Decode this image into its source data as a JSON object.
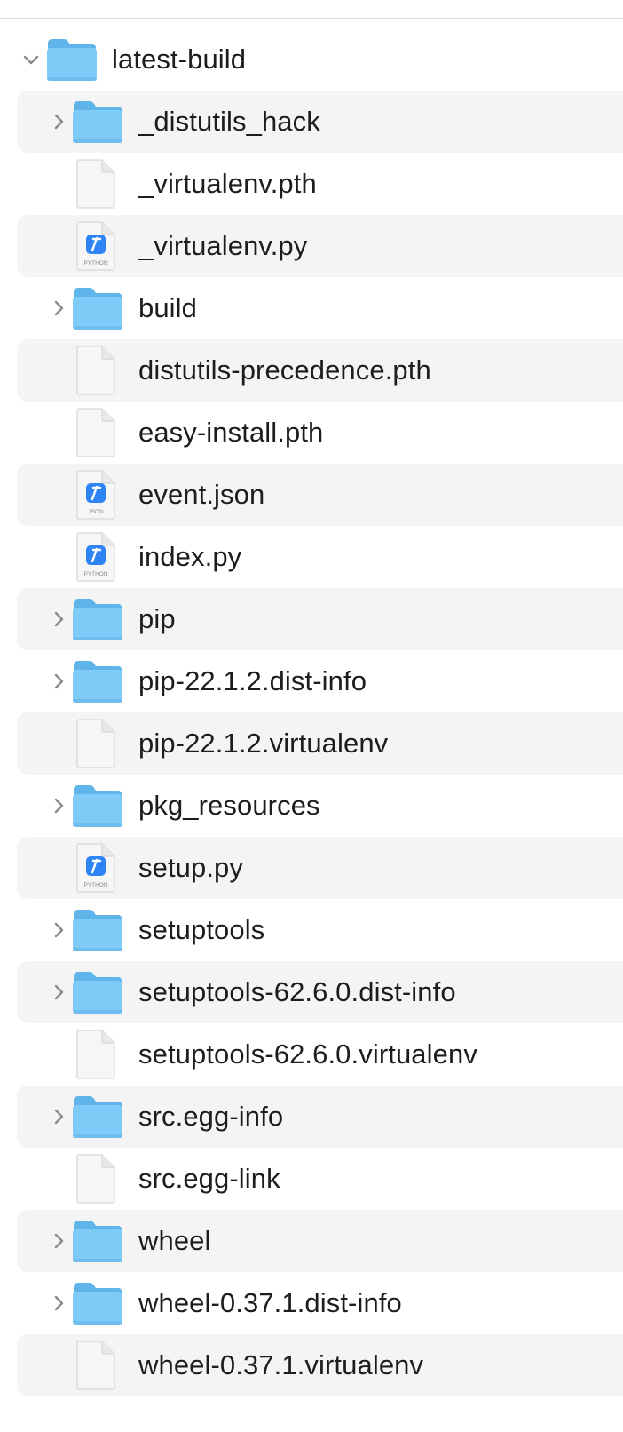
{
  "root": {
    "name": "latest-build",
    "icon": "folder-icon",
    "expanded": true
  },
  "items": [
    {
      "name": "_distutils_hack",
      "kind": "folder",
      "icon": "folder-icon"
    },
    {
      "name": "_virtualenv.pth",
      "kind": "file",
      "icon": "document-icon"
    },
    {
      "name": "_virtualenv.py",
      "kind": "python",
      "icon": "python-file-icon",
      "badge": "PYTHON"
    },
    {
      "name": "build",
      "kind": "folder",
      "icon": "folder-icon"
    },
    {
      "name": "distutils-precedence.pth",
      "kind": "file",
      "icon": "document-icon"
    },
    {
      "name": "easy-install.pth",
      "kind": "file",
      "icon": "document-icon"
    },
    {
      "name": "event.json",
      "kind": "json",
      "icon": "json-file-icon",
      "badge": "JSON"
    },
    {
      "name": "index.py",
      "kind": "python",
      "icon": "python-file-icon",
      "badge": "PYTHON"
    },
    {
      "name": "pip",
      "kind": "folder",
      "icon": "folder-icon"
    },
    {
      "name": "pip-22.1.2.dist-info",
      "kind": "folder",
      "icon": "folder-icon"
    },
    {
      "name": "pip-22.1.2.virtualenv",
      "kind": "file",
      "icon": "document-icon"
    },
    {
      "name": "pkg_resources",
      "kind": "folder",
      "icon": "folder-icon"
    },
    {
      "name": "setup.py",
      "kind": "python",
      "icon": "python-file-icon",
      "badge": "PYTHON"
    },
    {
      "name": "setuptools",
      "kind": "folder",
      "icon": "folder-icon"
    },
    {
      "name": "setuptools-62.6.0.dist-info",
      "kind": "folder",
      "icon": "folder-icon"
    },
    {
      "name": "setuptools-62.6.0.virtualenv",
      "kind": "file",
      "icon": "document-icon"
    },
    {
      "name": "src.egg-info",
      "kind": "folder",
      "icon": "folder-icon"
    },
    {
      "name": "src.egg-link",
      "kind": "file",
      "icon": "document-icon"
    },
    {
      "name": "wheel",
      "kind": "folder",
      "icon": "folder-icon"
    },
    {
      "name": "wheel-0.37.1.dist-info",
      "kind": "folder",
      "icon": "folder-icon"
    },
    {
      "name": "wheel-0.37.1.virtualenv",
      "kind": "file",
      "icon": "document-icon"
    }
  ],
  "colors": {
    "folder_body": "#7fcbf7",
    "folder_tab": "#5fb4ea",
    "accent_blue": "#2f84f5",
    "stripe": "#f4f4f4",
    "text": "#1d1d1f",
    "chevron": "#8a8a8a"
  }
}
